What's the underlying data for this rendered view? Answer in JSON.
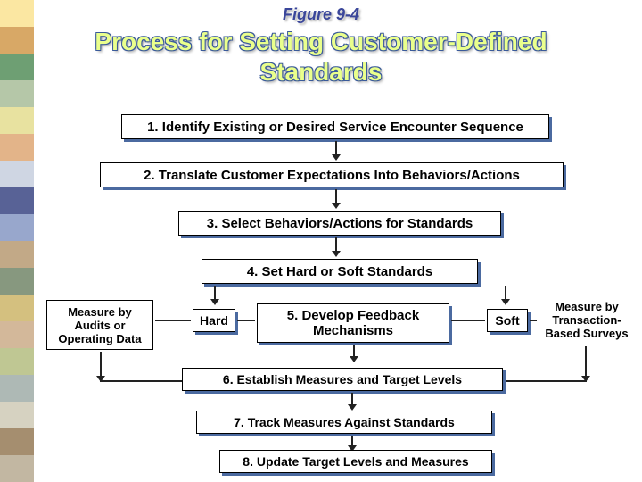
{
  "figure_label": "Figure 9-4",
  "title": "Process for Setting Customer-Defined Standards",
  "boxes": {
    "step1": "1. Identify Existing or Desired Service Encounter Sequence",
    "step2": "2. Translate Customer Expectations Into Behaviors/Actions",
    "step3": "3. Select Behaviors/Actions for Standards",
    "step4": "4. Set  Hard or Soft Standards",
    "measure_left": "Measure by Audits or Operating Data",
    "hard": "Hard",
    "step5": "5. Develop Feedback Mechanisms",
    "soft": "Soft",
    "measure_right": "Measure by Transaction-Based Surveys",
    "step6": "6. Establish Measures and Target Levels",
    "step7": "7. Track Measures Against Standards",
    "step8": "8.  Update Target Levels and Measures"
  },
  "sidebar_colors": [
    "#fbe7a2",
    "#d8a866",
    "#6e9f73",
    "#b5c7a8",
    "#e8e2a0",
    "#e3b489",
    "#cfd6e3",
    "#586296",
    "#98a7cc",
    "#c2a987",
    "#87987f",
    "#d4c07f",
    "#d3b89a",
    "#bfc793",
    "#aeb9b5",
    "#d6d2c1",
    "#a58e6f",
    "#c2b7a2"
  ]
}
